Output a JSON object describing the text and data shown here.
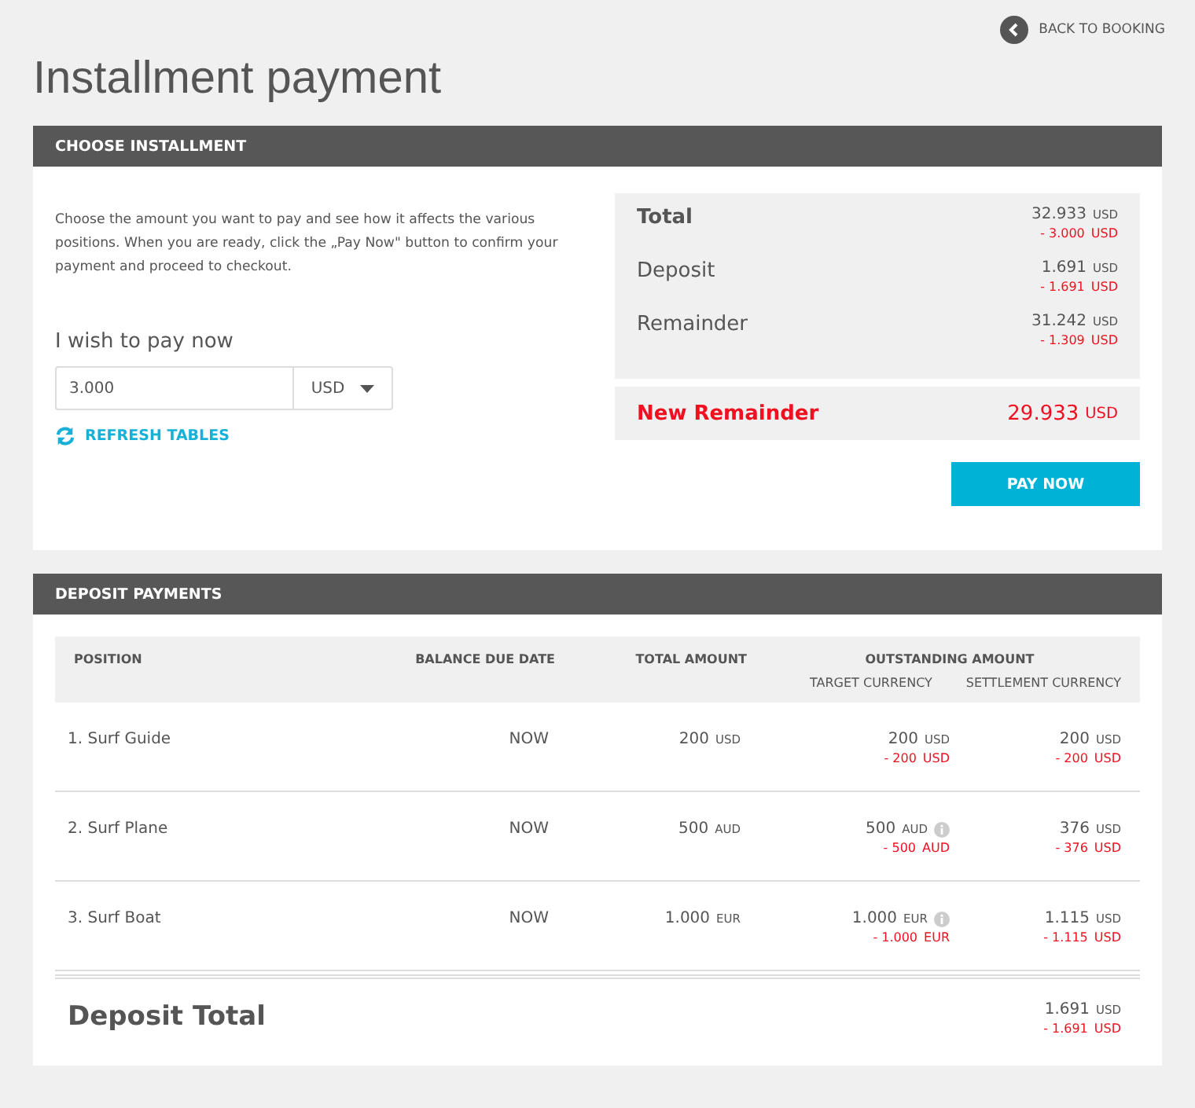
{
  "back_link": {
    "label": "BACK TO BOOKING"
  },
  "title": "Installment payment",
  "choose": {
    "header": "CHOOSE INSTALLMENT",
    "intro": "Choose the amount you want to pay and see how it affects the various positions. When you are ready, click the „Pay Now\" button to confirm your payment and proceed to checkout.",
    "amount_label": "I wish to pay now",
    "amount_value": "3.000",
    "currency": "USD",
    "refresh": "REFRESH TABLES",
    "summary": [
      {
        "label": "Total",
        "amount": "32.933",
        "currency": "USD",
        "change": {
          "amount": "- 3.000",
          "currency": "USD"
        }
      },
      {
        "label": "Deposit",
        "amount": "1.691",
        "currency": "USD",
        "change": {
          "amount": "- 1.691",
          "currency": "USD"
        }
      },
      {
        "label": "Remainder",
        "amount": "31.242",
        "currency": "USD",
        "change": {
          "amount": "- 1.309",
          "currency": "USD"
        }
      }
    ],
    "new_remainder": {
      "label": "New Remainder",
      "amount": "29.933",
      "currency": "USD"
    },
    "pay_button": "PAY NOW"
  },
  "deposits": {
    "header": "DEPOSIT PAYMENTS",
    "columns": {
      "position": "POSITION",
      "due": "BALANCE DUE DATE",
      "total": "TOTAL AMOUNT",
      "outstanding": "OUTSTANDING AMOUNT",
      "target": "TARGET CURRENCY",
      "settlement": "SETTLEMENT CURRENCY"
    },
    "rows": [
      {
        "position": "1. Surf Guide",
        "due": "NOW",
        "total": {
          "amount": "200",
          "currency": "USD"
        },
        "target": {
          "amount": "200",
          "currency": "USD",
          "info": false,
          "change": {
            "amount": "- 200",
            "currency": "USD"
          }
        },
        "settlement": {
          "amount": "200",
          "currency": "USD",
          "change": {
            "amount": "- 200",
            "currency": "USD"
          }
        }
      },
      {
        "position": "2. Surf Plane",
        "due": "NOW",
        "total": {
          "amount": "500",
          "currency": "AUD"
        },
        "target": {
          "amount": "500",
          "currency": "AUD",
          "info": true,
          "change": {
            "amount": "- 500",
            "currency": "AUD"
          }
        },
        "settlement": {
          "amount": "376",
          "currency": "USD",
          "change": {
            "amount": "- 376",
            "currency": "USD"
          }
        }
      },
      {
        "position": "3. Surf Boat",
        "due": "NOW",
        "total": {
          "amount": "1.000",
          "currency": "EUR"
        },
        "target": {
          "amount": "1.000",
          "currency": "EUR",
          "info": true,
          "change": {
            "amount": "- 1.000",
            "currency": "EUR"
          }
        },
        "settlement": {
          "amount": "1.115",
          "currency": "USD",
          "change": {
            "amount": "- 1.115",
            "currency": "USD"
          }
        }
      }
    ],
    "total": {
      "label": "Deposit Total",
      "amount": "1.691",
      "currency": "USD",
      "change": {
        "amount": "- 1.691",
        "currency": "USD"
      }
    }
  }
}
